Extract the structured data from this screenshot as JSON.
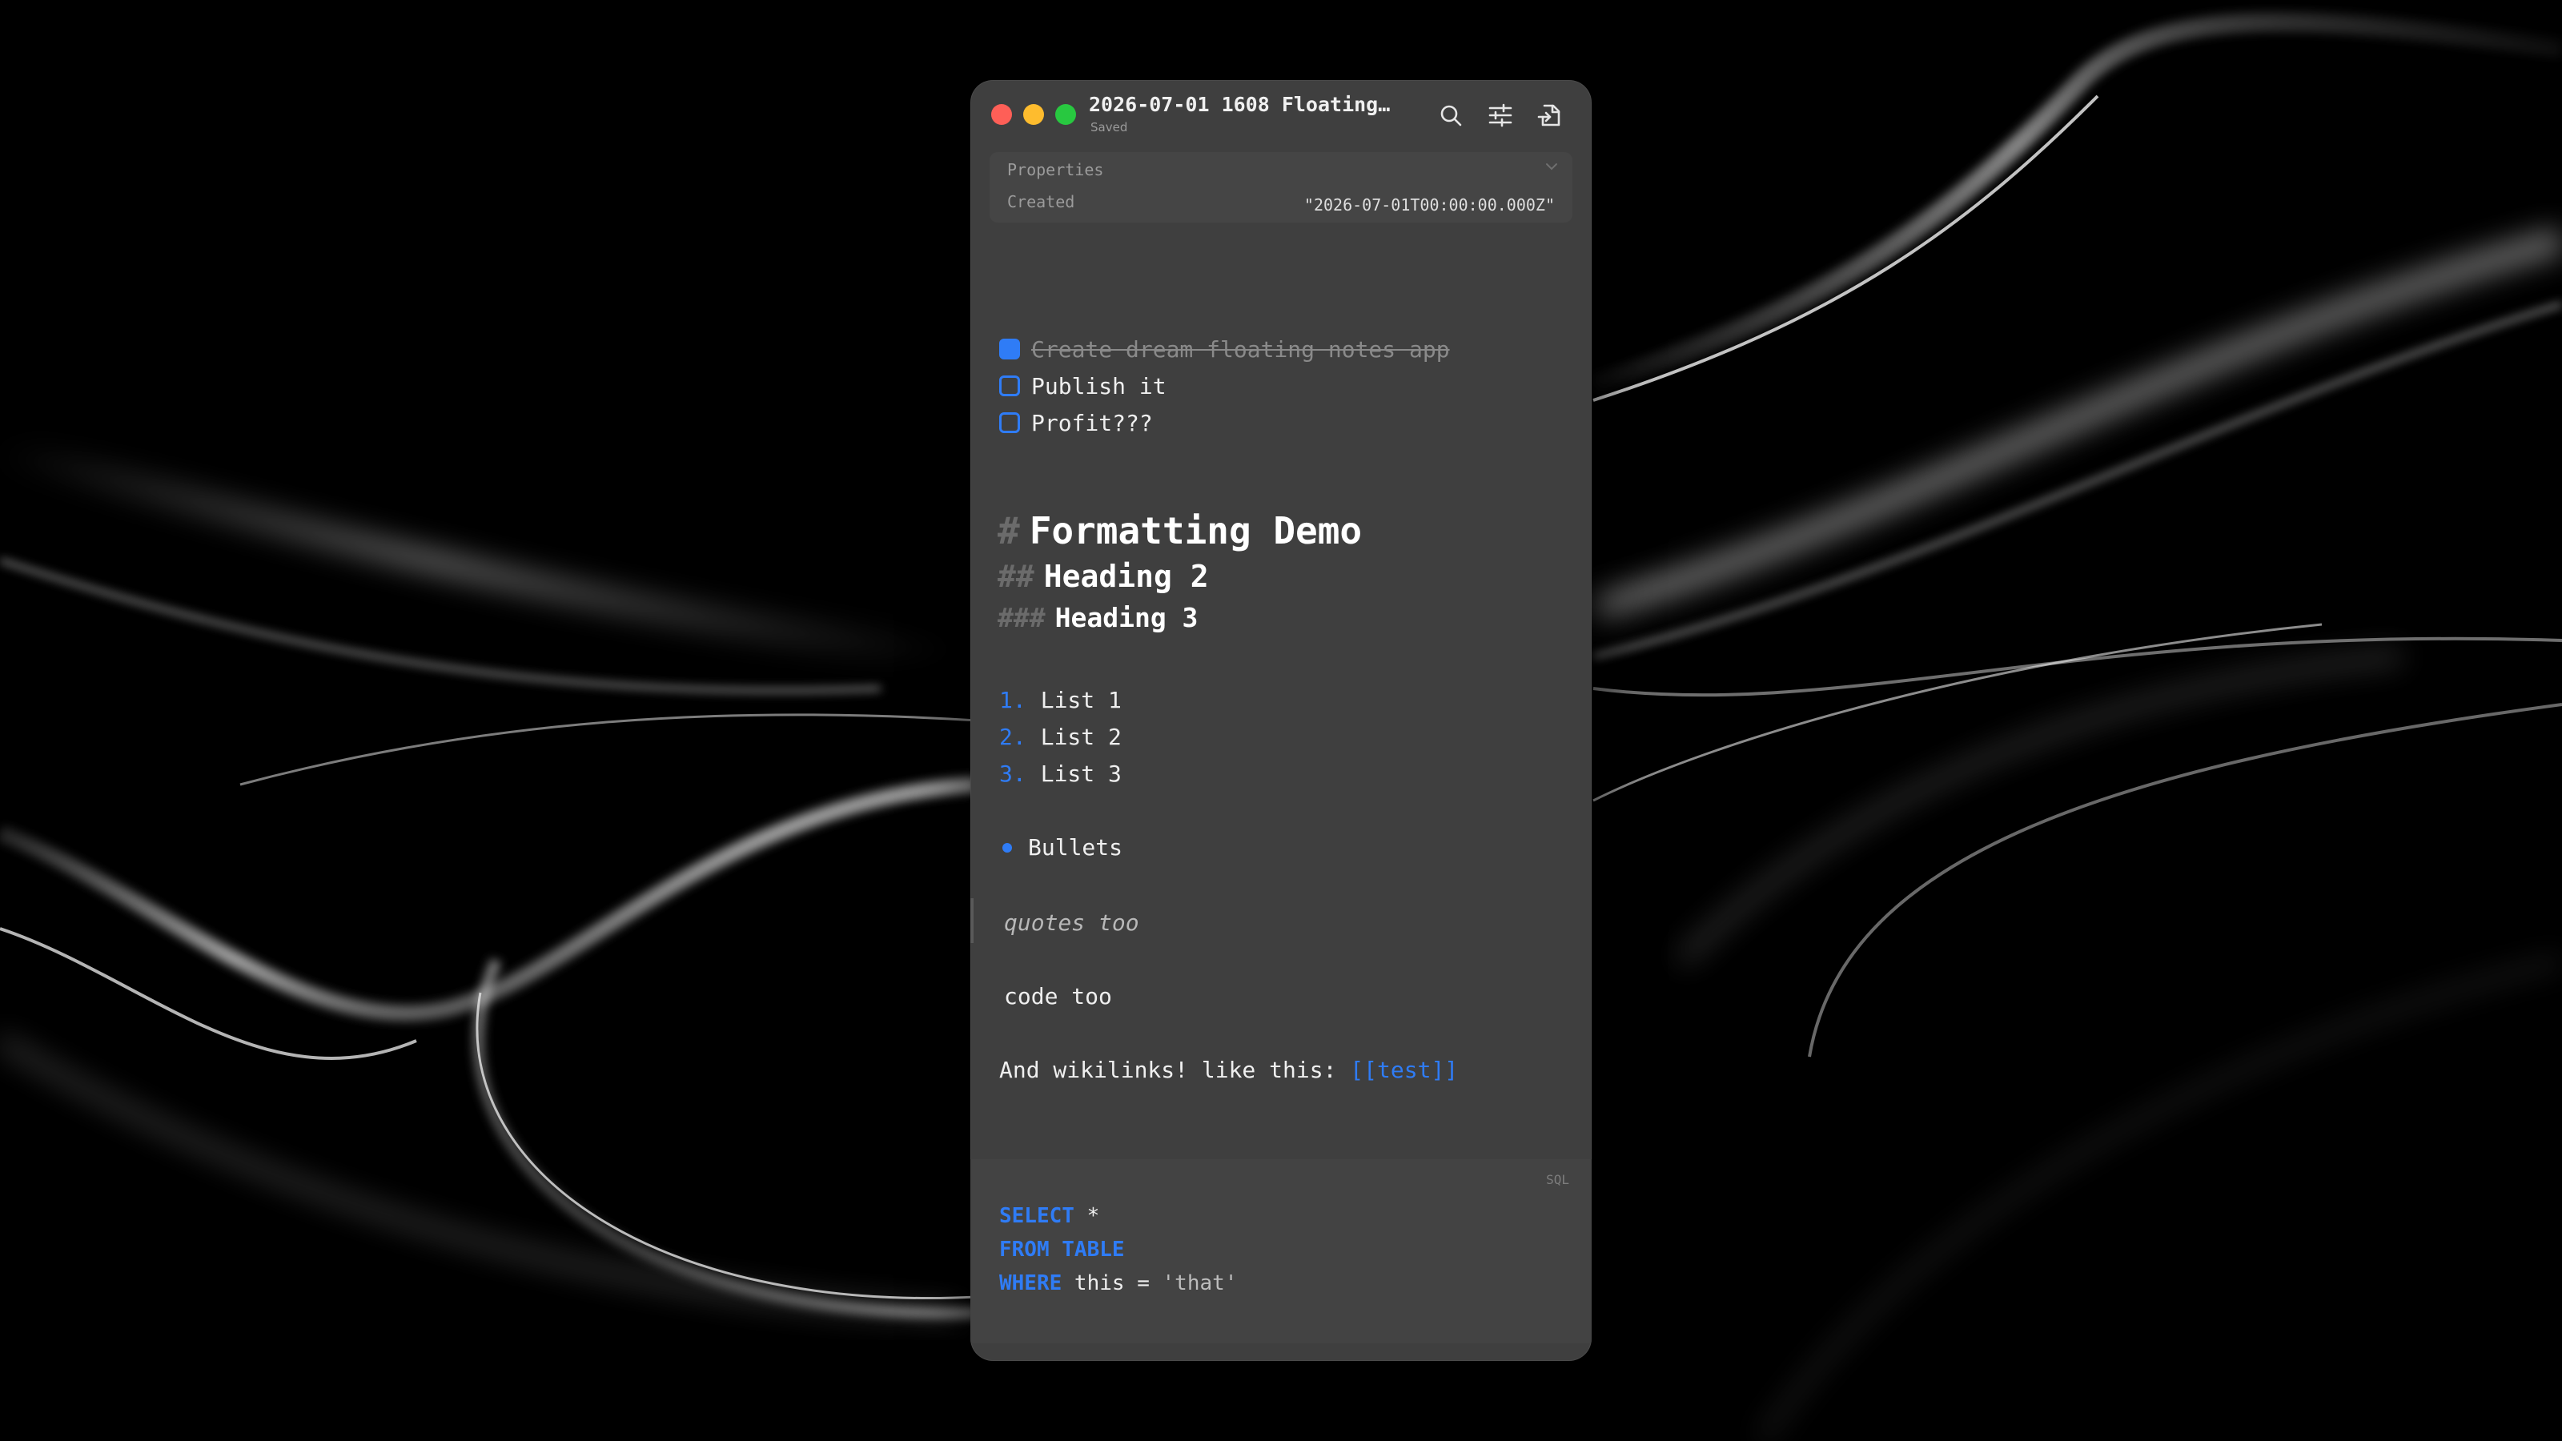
{
  "window": {
    "title": "2026-07-01 1608 Floating…",
    "status": "Saved"
  },
  "toolbar": {
    "icons": [
      "search-icon",
      "sliders-icon",
      "export-icon"
    ]
  },
  "properties": {
    "header": "Properties",
    "items": [
      {
        "key": "Created",
        "value": "\"2026-07-01T00:00:00.000Z\""
      }
    ]
  },
  "tasks": [
    {
      "text": "Create dream floating notes app",
      "checked": true
    },
    {
      "text": "Publish it",
      "checked": false
    },
    {
      "text": "Profit???",
      "checked": false
    }
  ],
  "headings": {
    "h1": {
      "marker": "#",
      "text": "Formatting Demo"
    },
    "h2": {
      "marker": "##",
      "text": "Heading 2"
    },
    "h3": {
      "marker": "###",
      "text": "Heading 3"
    }
  },
  "ordered_list": [
    {
      "num": "1.",
      "text": "List 1"
    },
    {
      "num": "2.",
      "text": "List 2"
    },
    {
      "num": "3.",
      "text": "List 3"
    }
  ],
  "bullets": [
    "Bullets"
  ],
  "quote": "quotes too",
  "inline_code": "code  too",
  "wikilink_line": {
    "prefix": "And wikilinks! like this: ",
    "link": "[[test]]"
  },
  "code_block": {
    "language": "SQL",
    "lines": [
      {
        "keyword": "SELECT",
        "rest": " *"
      },
      {
        "keyword": "FROM TABLE",
        "rest": ""
      },
      {
        "keyword": "WHERE",
        "rest": " this = ",
        "string": "'that'"
      }
    ]
  },
  "colors": {
    "accent": "#2f7cf6",
    "window_bg": "#3f3f3f",
    "traffic_red": "#fe5f57",
    "traffic_yellow": "#febc2e",
    "traffic_green": "#28c840"
  }
}
